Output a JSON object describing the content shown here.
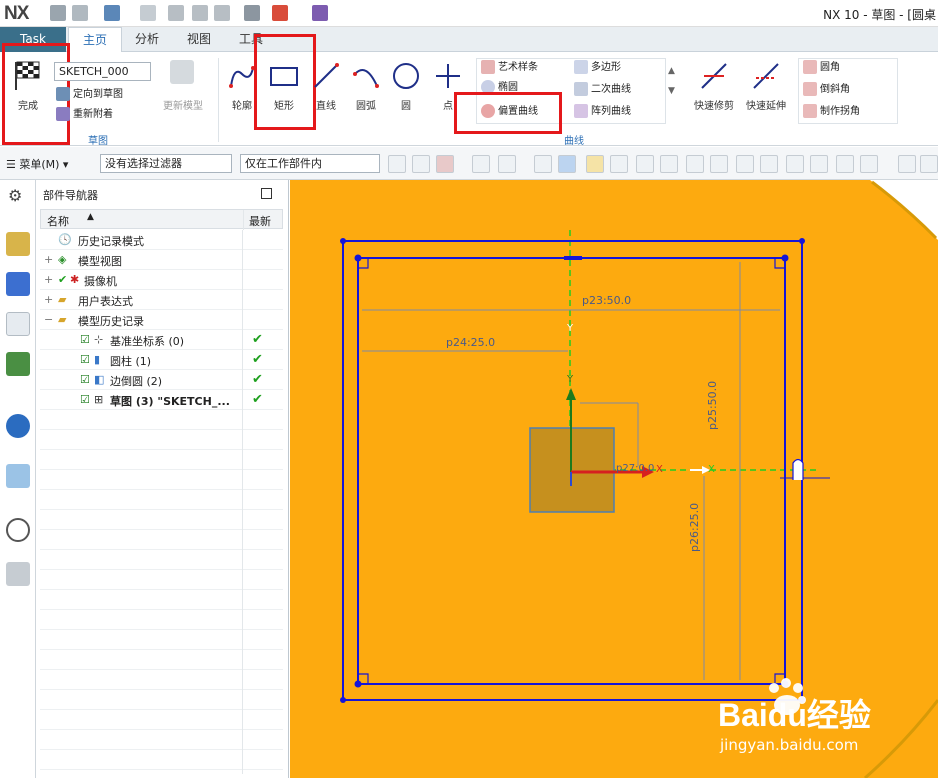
{
  "app": {
    "logo": "NX",
    "window_title": "NX 10 - 草图 - [圆桌"
  },
  "tabs": [
    {
      "label": "Task"
    },
    {
      "label": "主页"
    },
    {
      "label": "分析"
    },
    {
      "label": "视图"
    },
    {
      "label": "工具"
    }
  ],
  "ribbon": {
    "finish": {
      "label": "完成",
      "icon": "checkered-flag-icon"
    },
    "sketch_name": "SKETCH_000",
    "orient_to_sketch": "定向到草图",
    "reattach": "重新附着",
    "update_model": "更新模型",
    "sketch_group": "草图",
    "tools": [
      {
        "label": "轮廓"
      },
      {
        "label": "矩形"
      },
      {
        "label": "直线"
      },
      {
        "label": "圆弧"
      },
      {
        "label": "圆"
      },
      {
        "label": "点"
      }
    ],
    "curve_list_left": [
      "艺术样条",
      "椭圆",
      "偏置曲线"
    ],
    "curve_list_right": [
      "多边形",
      "二次曲线",
      "阵列曲线"
    ],
    "curve_group": "曲线",
    "quick_trim": "快速修剪",
    "quick_extend": "快速延伸",
    "corner_list": [
      "圆角",
      "倒斜角",
      "制作拐角"
    ]
  },
  "selection_bar": {
    "menu": "菜单(M)",
    "filter": "没有选择过滤器",
    "scope": "仅在工作部件内"
  },
  "navigator": {
    "title": "部件导航器",
    "col_name": "名称",
    "col_latest": "最新",
    "rows": [
      {
        "label": "历史记录模式",
        "check": ""
      },
      {
        "label": "模型视图",
        "check": ""
      },
      {
        "label": "摄像机",
        "check": ""
      },
      {
        "label": "用户表达式",
        "check": ""
      },
      {
        "label": "模型历史记录",
        "check": ""
      },
      {
        "label": "基准坐标系 (0)",
        "check": "✔"
      },
      {
        "label": "圆柱 (1)",
        "check": "✔"
      },
      {
        "label": "边倒圆 (2)",
        "check": "✔"
      },
      {
        "label": "草图 (3) \"SKETCH_...",
        "check": "✔"
      }
    ]
  },
  "sketch": {
    "dims": [
      "p23:50.0",
      "p24:25.0",
      "p25:50.0",
      "p26:25.0",
      "p27:0.0"
    ],
    "axis_y": "Y",
    "axis_x": "X"
  },
  "watermark": {
    "brand": "Baidu经验",
    "url": "jingyan.baidu.com"
  },
  "colors": {
    "canvas": "#fdaa0f",
    "sketch_blue": "#1515d8",
    "highlight_red": "#e4181b",
    "accent": "#2c6fb5"
  }
}
